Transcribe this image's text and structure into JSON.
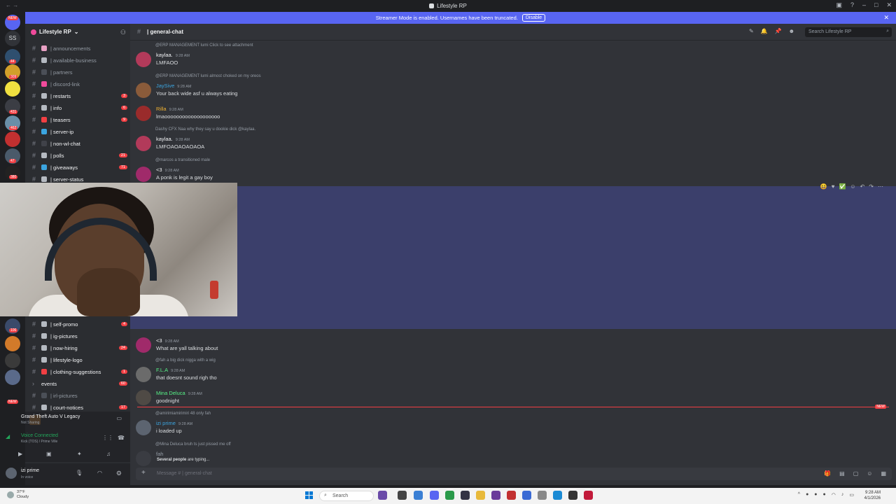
{
  "window": {
    "title": "Lifestyle RP"
  },
  "banner": {
    "text": "Streamer Mode is enabled. Usernames have been truncated.",
    "button": "Disable"
  },
  "server_list": {
    "home_badge": "NEW",
    "items": [
      {
        "label": "SS"
      },
      {
        "badge": "44"
      },
      {
        "badge": "309"
      },
      {
        "badge": ""
      },
      {
        "badge": "431"
      },
      {
        "badge": "462"
      },
      {
        "badge": ""
      },
      {
        "badge": "47"
      },
      {
        "badge": "380"
      },
      {
        "badge": "106"
      },
      {
        "badge": "NEW"
      }
    ]
  },
  "guild": {
    "name": "Lifestyle RP"
  },
  "channels": [
    {
      "name": "| announcements",
      "emoji_color": "#e8a1c4",
      "count": "",
      "muted": true
    },
    {
      "name": "| available-business",
      "emoji_color": "#b5bac1",
      "count": "",
      "muted": true
    },
    {
      "name": "| partners",
      "emoji_color": "#4b4f57",
      "count": "",
      "muted": true
    },
    {
      "name": "| discord-link",
      "emoji_color": "#f04a9b",
      "count": "",
      "muted": true
    },
    {
      "name": "| restarts",
      "emoji_color": "#b5bac1",
      "count": "3",
      "muted": false
    },
    {
      "name": "| info",
      "emoji_color": "#b5bac1",
      "count": "6",
      "muted": false
    },
    {
      "name": "| teasers",
      "emoji_color": "#f23f43",
      "count": "9",
      "muted": false
    },
    {
      "name": "| server-ip",
      "emoji_color": "#3ba5e0",
      "count": "",
      "muted": false
    },
    {
      "name": "| non-wl-chat",
      "emoji_color": "#404249",
      "count": "",
      "muted": false
    },
    {
      "name": "| polls",
      "emoji_color": "#b5bac1",
      "count": "21",
      "muted": false
    },
    {
      "name": "| giveaways",
      "emoji_color": "#3ba5e0",
      "count": "71",
      "muted": false
    },
    {
      "name": "| server-status",
      "emoji_color": "#b5bac1",
      "count": "",
      "muted": false
    },
    {
      "name": "| self-promo",
      "emoji_color": "#b5bac1",
      "count": "4",
      "muted": false
    },
    {
      "name": "| ig-pictures",
      "emoji_color": "#b5bac1",
      "count": "",
      "muted": false
    },
    {
      "name": "| now-hiring",
      "emoji_color": "#b5bac1",
      "count": "24",
      "muted": false
    },
    {
      "name": "| lifestyle-logo",
      "emoji_color": "#b5bac1",
      "count": "",
      "muted": false
    },
    {
      "name": "| clothing-suggestions",
      "emoji_color": "#f23f43",
      "count": "1",
      "muted": false
    },
    {
      "name": "events",
      "emoji_color": "",
      "count": "60",
      "muted": false
    },
    {
      "name": "| irl-pictures",
      "emoji_color": "#4b4f57",
      "count": "",
      "muted": true
    },
    {
      "name": "| court-notices",
      "emoji_color": "#b5bac1",
      "count": "17",
      "muted": false
    }
  ],
  "activity": {
    "game": "Grand Theft Auto V Legacy",
    "sub": "Not Sharing"
  },
  "voice": {
    "status": "Voice Connected",
    "channel": "Kick  (TOS) / Prime Ville"
  },
  "user": {
    "name": "izi prime",
    "status": "In voice"
  },
  "channel_header": {
    "name": "| general-chat",
    "search_placeholder": "Search Lifestyle RP"
  },
  "messages": [
    {
      "reply": "@ERP MANAGEMENT  lumi  Click to see attachment",
      "author": "kaylaa.",
      "author_color": "#f2f3f5",
      "time": "9:28 AM",
      "text": "LMFAOO",
      "avatar": "#b23a5a"
    },
    {
      "reply": "@ERP MANAGEMENT  lumi  almost choked on my oreos",
      "author": "JaySive",
      "author_color": "#3ba5e0",
      "time": "9:28 AM",
      "text": "Your back wide asf u always eating",
      "avatar": "#8a5b3a"
    },
    {
      "reply": "",
      "author": "Rilla",
      "author_color": "#f0b232",
      "time": "9:28 AM",
      "text": "lmaooooooooooooooooooo",
      "avatar": "#9a2b2b"
    },
    {
      "reply": "Dashy  CFX  Naa why they say u dookie dick @kaylaa.",
      "author": "kaylaa.",
      "author_color": "#f2f3f5",
      "time": "9:28 AM",
      "text": "LMFOAOAOAOAOA",
      "avatar": "#b23a5a"
    },
    {
      "reply": "@marcos  a transitioned male",
      "author": "<3",
      "author_color": "#f2f3f5",
      "time": "9:28 AM",
      "text": "A ponk is legit a gay boy",
      "avatar": "#a02a6a"
    },
    {
      "reply": "",
      "author": "<3",
      "author_color": "#f2f3f5",
      "time": "9:28 AM",
      "text": "What are yall talking about",
      "avatar": "#a02a6a"
    },
    {
      "reply": "@fah  a big dick nigga with a wig",
      "author": "F.L.A",
      "author_color": "#57f287",
      "time": "9:28 AM",
      "text": "that doesnt sound righ tho",
      "avatar": "#6b6b6b"
    },
    {
      "reply": "",
      "author": "Mina Deluca",
      "author_color": "#57f287",
      "time": "9:28 AM",
      "text": "goodnight",
      "avatar": "#4f4a45"
    },
    {
      "reply": "@amirimiamirimiri  48  only fah",
      "author": "izi prime",
      "author_color": "#3ba5e0",
      "time": "9:28 AM",
      "text": "i loaded up",
      "avatar": "#5c6470"
    },
    {
      "reply": "@Mina Deluca  bruh ts just pissed me off",
      "author": "fah",
      "author_color": "#949ba4",
      "time": "",
      "text": "",
      "avatar": "#3a3c42"
    }
  ],
  "new_marker": "NEW",
  "typing": {
    "who": "Several people",
    "rest": " are typing..."
  },
  "composer": {
    "placeholder": "Message #   | general-chat"
  },
  "taskbar": {
    "weather_temp": "37°F",
    "weather_desc": "Cloudy",
    "search": "Search",
    "time": "9:28 AM",
    "date": "4/1/2026"
  }
}
